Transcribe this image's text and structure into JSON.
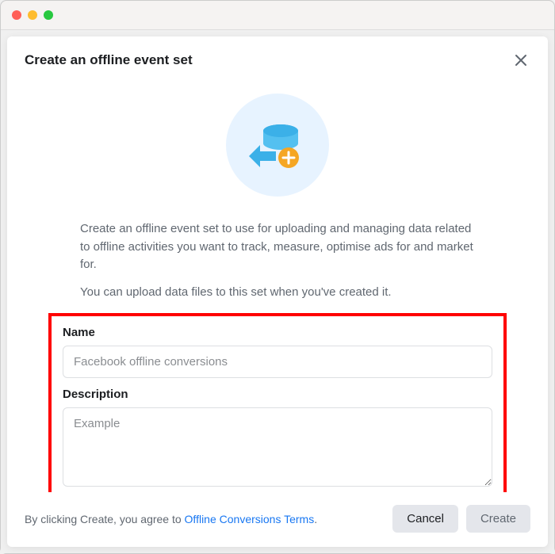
{
  "modal": {
    "title": "Create an offline event set",
    "description1": "Create an offline event set to use for uploading and managing data related to offline activities you want to track, measure, optimise ads for and market for.",
    "description2": "You can upload data files to this set when you've created it.",
    "form": {
      "nameLabel": "Name",
      "nameValue": "Facebook offline conversions",
      "descriptionLabel": "Description",
      "descriptionValue": "Example"
    },
    "footer": {
      "agreeText": "By clicking Create, you agree to ",
      "linkText": "Offline Conversions Terms",
      "period": ".",
      "cancelLabel": "Cancel",
      "createLabel": "Create"
    }
  }
}
